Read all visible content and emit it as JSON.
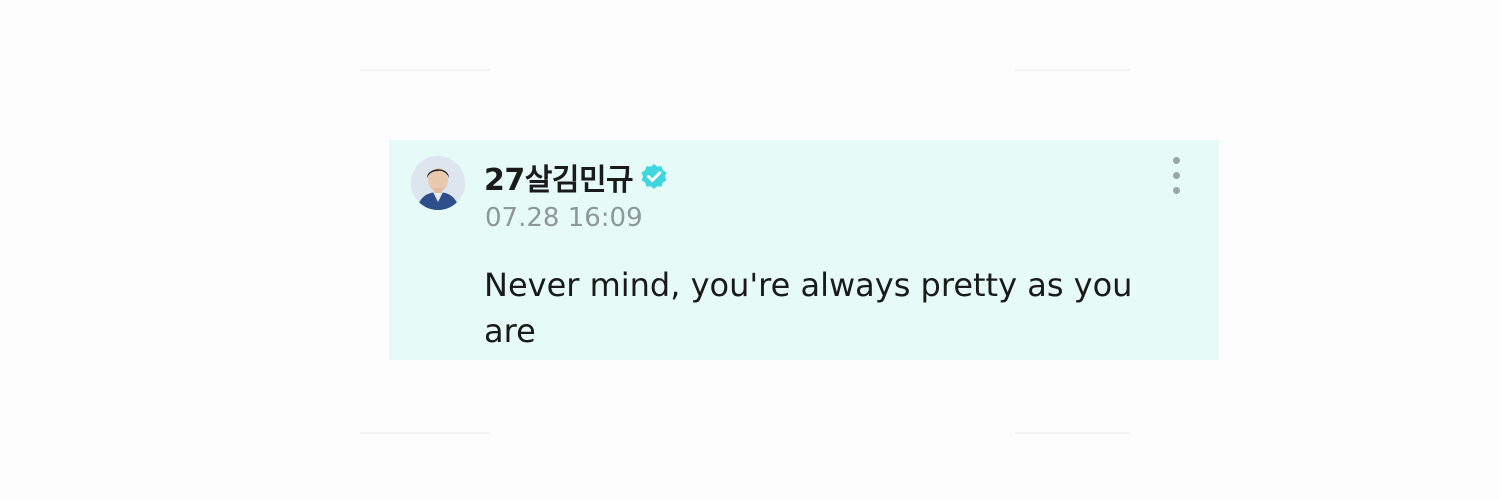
{
  "post": {
    "username": "27살김민규",
    "timestamp": "07.28 16:09",
    "message": "Never mind, you're always pretty as you are",
    "verified": true
  },
  "icons": {
    "avatar": "profile-photo",
    "verified": "verified-badge-icon",
    "more": "more-options-vertical-icon"
  },
  "colors": {
    "card_background": "#e6fbf7",
    "verified_badge": "#3fd6e0",
    "text_primary": "#1a1a1a",
    "text_secondary": "#8e979c"
  }
}
